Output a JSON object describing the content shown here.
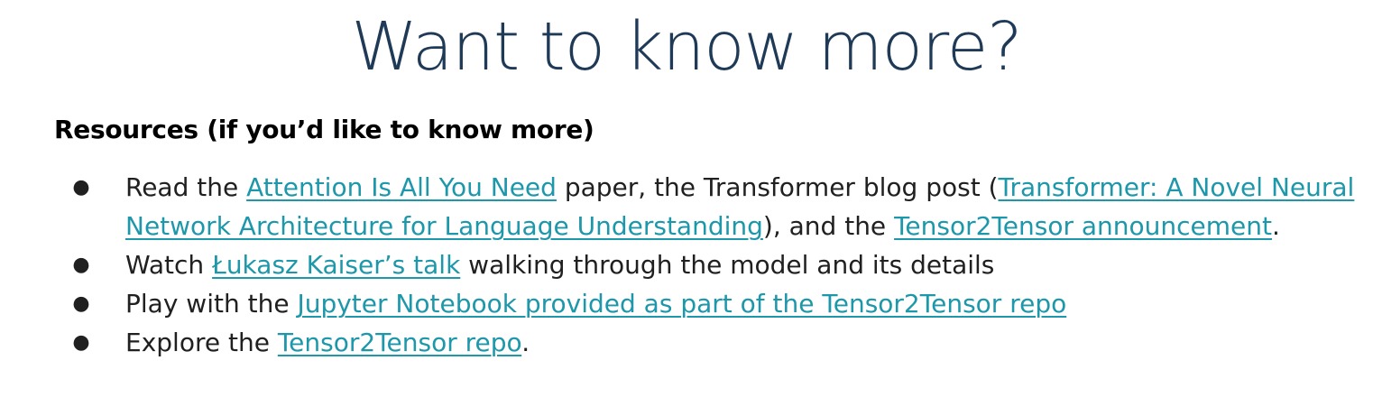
{
  "title": "Want to know more?",
  "heading": "Resources (if you’d like to know more)",
  "colors": {
    "title": "#1f3a57",
    "link": "#1d97aa",
    "text": "#202020"
  },
  "bullet_glyph": "●",
  "items": [
    {
      "t1": "Read the ",
      "link1": "Attention Is All You Need",
      "t2": " paper, the Transformer blog post (",
      "link2": "Transformer: A Novel Neural Network Architecture for Language Understanding",
      "t3": "), and the ",
      "link3": "Tensor2Tensor announcement",
      "t4": "."
    },
    {
      "t1": "Watch ",
      "link1": "Łukasz Kaiser’s talk",
      "t2": " walking through the model and its details"
    },
    {
      "t1": "Play with the ",
      "link1": "Jupyter Notebook provided as part of the Tensor2Tensor repo"
    },
    {
      "t1": "Explore the ",
      "link1": "Tensor2Tensor repo",
      "t2": "."
    }
  ]
}
